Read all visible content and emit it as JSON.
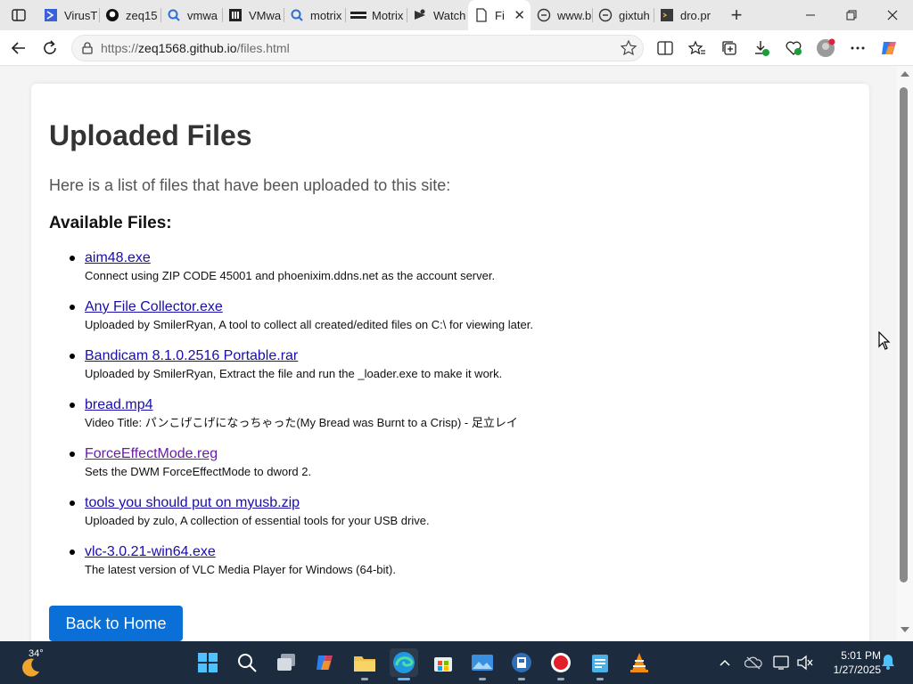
{
  "browser": {
    "tabs": [
      {
        "title": "VirusT",
        "icon": "virustotal-icon"
      },
      {
        "title": "zeq15",
        "icon": "github-icon"
      },
      {
        "title": "vmwa",
        "icon": "search-icon"
      },
      {
        "title": "VMwa",
        "icon": "vmware-icon"
      },
      {
        "title": "motrix",
        "icon": "search-icon"
      },
      {
        "title": "Motrix",
        "icon": "motrix-icon"
      },
      {
        "title": "Watch",
        "icon": "video-icon"
      },
      {
        "title": "Fi",
        "icon": "page-icon",
        "active": true
      },
      {
        "title": "www.b",
        "icon": "link-icon"
      },
      {
        "title": "gixtuh",
        "icon": "link-icon"
      },
      {
        "title": "dro.pr",
        "icon": "terminal-icon"
      }
    ],
    "address_prefix": "https://",
    "address_host": "zeq1568.github.io",
    "address_path": "/files.html"
  },
  "page": {
    "title": "Uploaded Files",
    "intro": "Here is a list of files that have been uploaded to this site:",
    "section_title": "Available Files:",
    "files": [
      {
        "name": "aim48.exe",
        "desc": "Connect using ZIP CODE 45001 and phoenixim.ddns.net as the account server."
      },
      {
        "name": "Any File Collector.exe",
        "desc": "Uploaded by SmilerRyan, A tool to collect all created/edited files on C:\\ for viewing later."
      },
      {
        "name": "Bandicam 8.1.0.2516 Portable.rar",
        "desc": "Uploaded by SmilerRyan, Extract the file and run the _loader.exe to make it work."
      },
      {
        "name": "bread.mp4",
        "desc": "Video Title: パンこげこげになっちゃった(My Bread was Burnt to a Crisp) - 足立レイ"
      },
      {
        "name": "ForceEffectMode.reg",
        "desc": "Sets the DWM ForceEffectMode to dword 2.",
        "visited": true
      },
      {
        "name": "tools you should put on myusb.zip",
        "desc": "Uploaded by zulo, A collection of essential tools for your USB drive."
      },
      {
        "name": "vlc-3.0.21-win64.exe",
        "desc": "The latest version of VLC Media Player for Windows (64-bit)."
      }
    ],
    "home_button": "Back to Home"
  },
  "taskbar": {
    "temperature": "34°",
    "time": "5:01 PM",
    "date": "1/27/2025"
  },
  "colors": {
    "link": "#1a0dab",
    "visited_link": "#681da8",
    "button": "#0a6fd6",
    "taskbar": "#1c2b3e"
  }
}
